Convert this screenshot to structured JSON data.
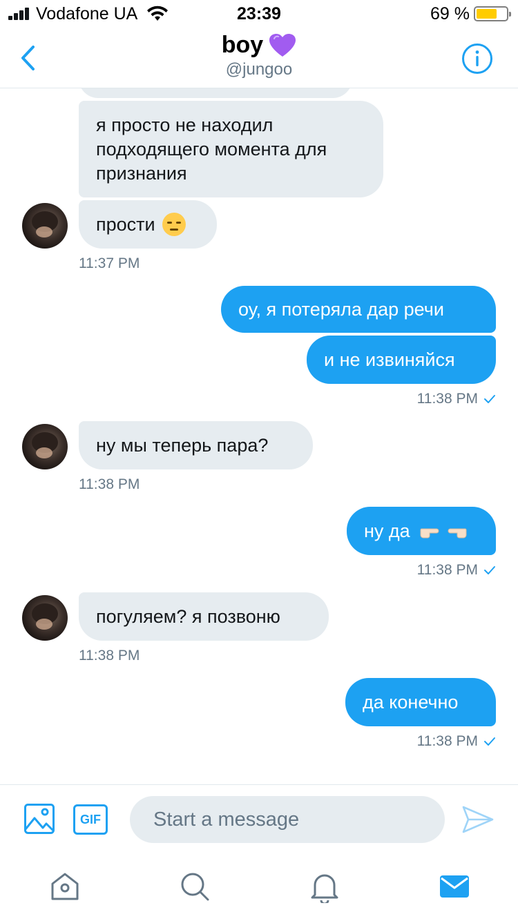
{
  "status_bar": {
    "carrier": "Vodafone UA",
    "time": "23:39",
    "battery_percent_label": "69 %",
    "battery_level": 0.69,
    "signal_bars": 4
  },
  "header": {
    "title": "boy",
    "title_icon": "purple-heart-icon",
    "handle": "@jungoo",
    "back_icon": "chevron-left-icon",
    "info_icon": "info-icon"
  },
  "messages": [
    {
      "from": "them",
      "text": "я просто не находил подходящего момента для признания"
    },
    {
      "from": "them",
      "text": "прости",
      "emoji": "pensive-face-icon"
    },
    {
      "time": "11:37 PM",
      "side": "left"
    },
    {
      "from": "me",
      "text": "оу, я потеряла дар речи"
    },
    {
      "from": "me",
      "text": "и не извиняйся"
    },
    {
      "time": "11:38 PM",
      "side": "right"
    },
    {
      "from": "them",
      "text": "ну мы теперь пара?"
    },
    {
      "time": "11:38 PM",
      "side": "left"
    },
    {
      "from": "me",
      "text": "ну да",
      "emoji": "pointing-fingers-icon"
    },
    {
      "time": "11:38 PM",
      "side": "right"
    },
    {
      "from": "them",
      "text": "погуляем? я позвоню"
    },
    {
      "time": "11:38 PM",
      "side": "left"
    },
    {
      "from": "me",
      "text": "да конечно"
    },
    {
      "time": "11:38 PM",
      "side": "right"
    }
  ],
  "composer": {
    "placeholder": "Start a message",
    "gif_label": "GIF",
    "image_icon": "image-icon",
    "send_icon": "send-icon"
  },
  "tab_bar": {
    "items": [
      "home-icon",
      "search-icon",
      "notifications-icon",
      "messages-icon"
    ],
    "active": "messages-icon"
  },
  "colors": {
    "accent": "#1da1f2",
    "incoming_bubble": "#e6ecf0",
    "secondary_text": "#657786",
    "battery": "#ffcc00",
    "heart": "#a15cf0"
  }
}
